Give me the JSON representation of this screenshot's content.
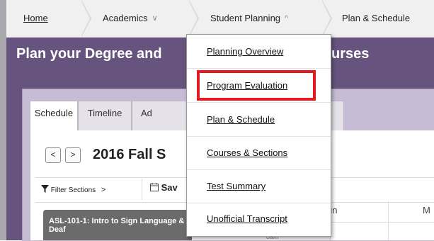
{
  "breadcrumb": {
    "home": "Home",
    "academics": "Academics",
    "student_planning": "Student Planning",
    "plan_schedule": "Plan & Schedule",
    "chevron_down": "∨",
    "chevron_up": "^"
  },
  "header": {
    "title_left": "Plan your Degree and",
    "title_right": "urses"
  },
  "tabs": [
    {
      "label": "Schedule"
    },
    {
      "label": "Timeline"
    },
    {
      "label": "Ad"
    }
  ],
  "schedule": {
    "prev": "<",
    "next": ">",
    "term": "2016 Fall S",
    "filter": "Filter Sections",
    "filter_chevron": ">",
    "save": "Sav",
    "course": "ASL-101-1: Intro to Sign Language & Deaf",
    "course_line2": "",
    "day_sun": "un",
    "day_mon": "M",
    "time_fragment": "oam"
  },
  "dropdown": {
    "items": [
      "Planning Overview",
      "Program Evaluation",
      "Plan & Schedule",
      "Courses & Sections",
      "Test Summary",
      "Unofficial Transcript"
    ],
    "highlighted_index": 1,
    "highlight_color": "#e21b23"
  },
  "colors": {
    "header_purple": "#67547e",
    "panel_lavender": "#c7bcd6"
  },
  "icons": {
    "filter": "filter-funnel-icon",
    "calendar": "calendar-icon"
  }
}
